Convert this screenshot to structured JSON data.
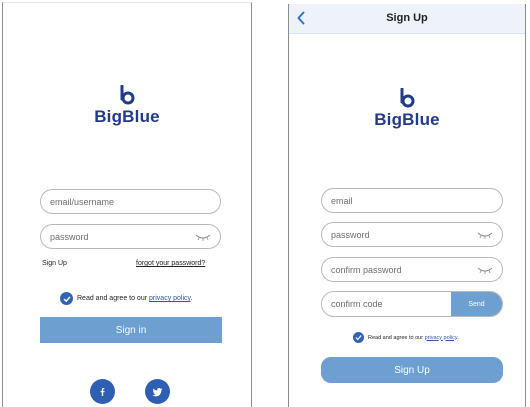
{
  "colors": {
    "brand": "#223a8a",
    "accent": "#6d9fd0",
    "check": "#2f63b6",
    "social": "#2f5fb3",
    "navbar": "#eef3f9"
  },
  "login": {
    "brand_name": "BigBlue",
    "email_placeholder": "email/username",
    "password_placeholder": "password",
    "sign_up_link": "Sign Up",
    "forgot_link": "forgot your password?",
    "agree_text": "Read and agree to our",
    "policy_link": "privacy policy",
    "agree_end": ".",
    "sign_in_button": "Sign in",
    "social_icons": [
      "facebook-icon",
      "twitter-icon"
    ]
  },
  "signup": {
    "title": "Sign Up",
    "brand_name": "BigBlue",
    "email_placeholder": "email",
    "password_placeholder": "password",
    "confirm_password_placeholder": "confirm password",
    "confirm_code_placeholder": "confirm code",
    "send_button": "Send",
    "agree_text": "Read and agree to our",
    "policy_link": "privacy policy",
    "agree_end": ".",
    "sign_up_button": "Sign Up"
  }
}
